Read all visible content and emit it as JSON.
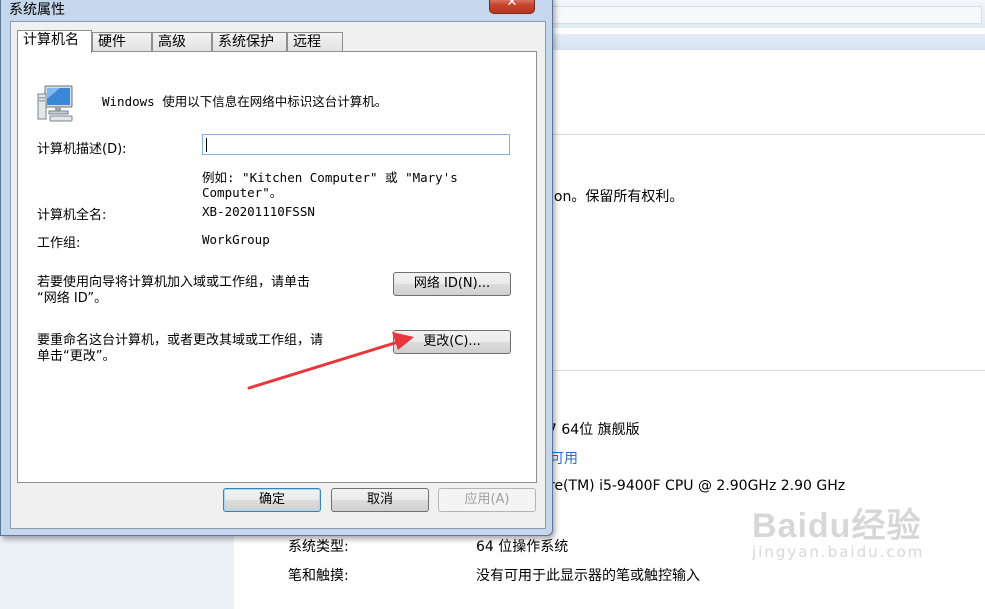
{
  "background": {
    "copyright_fragment": "ion。保留所有权利。",
    "edition": "7 64位 旗舰版",
    "availability_link": "可用",
    "cpu": "re(TM) i5-9400F CPU @ 2.90GHz   2.90 GHz",
    "system_type_label": "系统类型:",
    "system_type_value": "64 位操作系统",
    "pen_touch_label": "笔和触摸:",
    "pen_touch_value": "没有可用于此显示器的笔或触控输入"
  },
  "watermark": {
    "logo": "Baidu经验",
    "url": "jingyan.baidu.com"
  },
  "dialog": {
    "title": "系统属性",
    "close_glyph": "✕",
    "tabs": [
      {
        "label": "计算机名",
        "active": true
      },
      {
        "label": "硬件",
        "active": false
      },
      {
        "label": "高级",
        "active": false
      },
      {
        "label": "系统保护",
        "active": false
      },
      {
        "label": "远程",
        "active": false
      }
    ],
    "intro": "Windows 使用以下信息在网络中标识这台计算机。",
    "description_label": "计算机描述(D):",
    "description_value": "",
    "example_line1": "例如: \"Kitchen Computer\" 或 \"Mary's",
    "example_line2": "Computer\"。",
    "fullname_label": "计算机全名:",
    "fullname_value": "XB-20201110FSSN",
    "workgroup_label": "工作组:",
    "workgroup_value": "WorkGroup",
    "netid_text_line1": "若要使用向导将计算机加入域或工作组，请单击",
    "netid_text_line2": "“网络 ID”。",
    "netid_button": "网络 ID(N)...",
    "rename_text_line1": "要重命名这台计算机，或者更改其域或工作组，请",
    "rename_text_line2": "单击“更改”。",
    "change_button": "更改(C)...",
    "ok_button": "确定",
    "cancel_button": "取消",
    "apply_button": "应用(A)"
  },
  "colors": {
    "arrow": "#e8383d",
    "link": "#2a6fc9",
    "close": "#c7442c"
  },
  "icons": {
    "computer": "computer-monitor-icon",
    "close": "close-icon"
  }
}
